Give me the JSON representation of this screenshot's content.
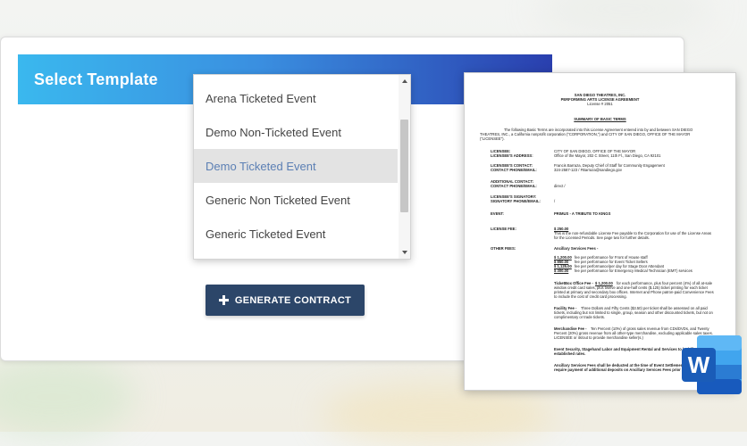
{
  "header": {
    "title": "Select Template"
  },
  "template_list": {
    "items": [
      {
        "label": "Arena Ticketed Event",
        "selected": false
      },
      {
        "label": "Demo Non-Ticketed Event",
        "selected": false
      },
      {
        "label": "Demo Ticketed Event",
        "selected": true
      },
      {
        "label": "Generic Non Ticketed Event",
        "selected": false
      },
      {
        "label": "Generic Ticketed Event",
        "selected": false
      }
    ]
  },
  "generate_button": {
    "label": "GENERATE CONTRACT",
    "icon": "plus-icon"
  },
  "document_preview": {
    "org": "SAN DIEGO THEATRES, INC.",
    "agreement": "PERFORMING ARTS LICENSE AGREEMENT",
    "license_no": "License # 2051",
    "summary_heading": "SUMMARY OF BASIC TERMS",
    "intro1": "The following Basic Terms are incorporated into this License Agreement entered into by and between SAN DIEGO",
    "intro2": "THEATRES, INC., a California nonprofit corporation (\"CORPORATION,\") and CITY OF SAN DIEGO, OFFICE OF THE MAYOR",
    "intro3": "(\"LICENSEE\").",
    "licensee_label": "LICENSEE:",
    "licensee_value": "CITY OF SAN DIEGO, OFFICE OF THE MAYOR",
    "address_label": "LICENSEE'S ADDRESS:",
    "address_value": "Office of the Mayor, 202 C Street, 11th Fl., San Diego, CA 92101",
    "contact_label": "LICENSEE'S CONTACT:",
    "contact_value": "Francis Barraza, Deputy Chief of Staff for Community Engagement",
    "contact_phone_label": "CONTACT PHONE/EMAIL:",
    "contact_phone_value": "324-2587-123 / FBarraza@sandiego.gov",
    "additional_contact_label": "ADDITIONAL CONTACT:",
    "additional_phone_label": "CONTACT PHONE/EMAIL:",
    "additional_value": "direct /",
    "signatory_label": "LICENSEE'S SIGNATORY:",
    "signatory_phone_label": "SIGNATORY PHONE/EMAIL:",
    "signatory_value": "/",
    "event_label": "EVENT:",
    "event_value": "PRIMUS - A TRIBUTE TO KINGS",
    "license_fee_label": "LICENSE FEE:",
    "license_fee_amount": "$ 250.00",
    "license_fee_text1": "This is the non-refundable License Fee payable to the Corporation for use of the License Areas",
    "license_fee_text2": "for the Licensed Periods. See page two for further details.",
    "other_fees_label": "OTHER FEES:",
    "ancillary_heading": "Ancillary Services Fees -",
    "fee1_amount": "$ 1,200.00",
    "fee1_text": "fee per performance for Front of House staff",
    "fee2_amount": "$ 850.00",
    "fee2_text": "fee per performance for Event Ticket Sellers",
    "fee3_amount": "$ 1,125.00",
    "fee3_text": "fee per performance/per day for Stage Door Attendant",
    "fee4_amount": "$ 300.00",
    "fee4_text": "fee per performance for Emergency Medical Technician (EMT) services",
    "ticketbox_label": "TicketBox Office Fee -",
    "ticketbox_amount": "$ 1,200.00",
    "ticketbox_text1": "for each performance, plus four percent (4%) of all at-sale",
    "ticketbox_text2": "window credit card sales, plus twelve and one-half cents ($.125) ticket printing for each ticket",
    "ticketbox_text3": "printed at primary and secondary box offices. Internet and Phone patron-paid Convenience Fees",
    "ticketbox_text4": "to include the cost of credit card processing.",
    "facility_label": "Facility Fee -",
    "facility_text1": "Three Dollars and Fifty Cents ($3.50) per ticket shall be assessed on all paid",
    "facility_text2": "tickets, including but not limited to single, group, season and other discounted tickets, but not on",
    "facility_text3": "complimentary or trade tickets.",
    "merch_label": "Merchandise Fee -",
    "merch_text1": "Ten Percent (10%) of gross sales revenue from CDs/DVDs, and Twenty",
    "merch_text2": "Percent (20%) gross revenue from all other-type merchandise, excluding applicable sales taxes.",
    "merch_text3": "LICENSEE or its/out to provide merchandise seller(s.)",
    "security_text1": "Event Security, Stagehand Labor and Equipment Rental and Services to be billed at",
    "security_text2": "established rates.",
    "ancillary_text1": "Ancillary Services Fees shall be deducted at the time of Event Settlement and",
    "ancillary_text2": "require payment of additional deposits on Ancillary Services Fees prior to"
  },
  "word_badge": {
    "letter": "W",
    "icon": "microsoft-word-icon",
    "colors": {
      "dark": "#1a5cb8",
      "mid": "#2b7cd3",
      "light": "#41a5ee",
      "lightest": "#5fb8f5"
    }
  }
}
